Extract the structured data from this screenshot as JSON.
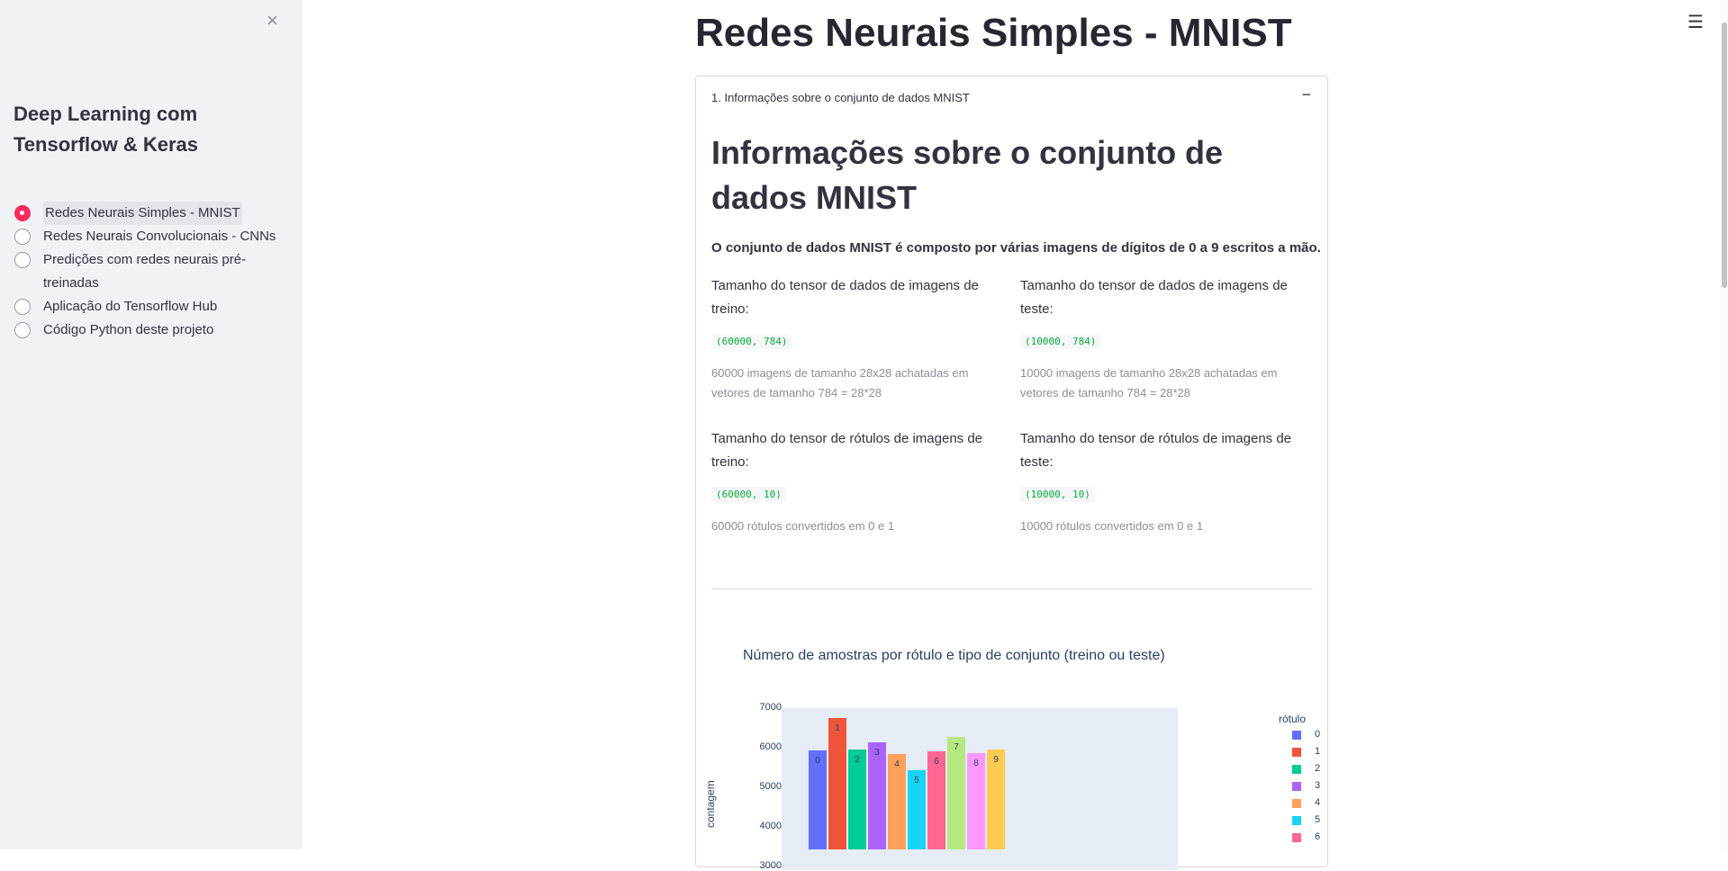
{
  "sidebar": {
    "close_icon": "×",
    "title": "Deep Learning com Tensorflow & Keras",
    "options": [
      {
        "label": "Redes Neurais Simples - MNIST",
        "selected": true
      },
      {
        "label": "Redes Neurais Convolucionais - CNNs",
        "selected": false
      },
      {
        "label": "Predições com redes neurais pré-treinadas",
        "selected": false
      },
      {
        "label": "Aplicação do Tensorflow Hub",
        "selected": false
      },
      {
        "label": "Código Python deste projeto",
        "selected": false
      }
    ]
  },
  "header": {
    "menu_icon": "☰",
    "title": "Redes Neurais Simples - MNIST"
  },
  "expander": {
    "title": "1. Informações sobre o conjunto de dados MNIST",
    "toggle": "−",
    "heading": "Informações sobre o conjunto de dados MNIST",
    "intro": "O conjunto de dados MNIST é composto por várias imagens de dígitos de 0 a 9 escritos a mão.",
    "blocks": [
      {
        "label": "Tamanho do tensor de dados de imagens de treino:",
        "code": "(60000, 784)",
        "caption": "60000 imagens de tamanho 28x28 achatadas em vetores de tamanho 784 = 28*28"
      },
      {
        "label": "Tamanho do tensor de dados de imagens de teste:",
        "code": "(10000, 784)",
        "caption": "10000 imagens de tamanho 28x28 achatadas em vetores de tamanho 784 = 28*28"
      },
      {
        "label": "Tamanho do tensor de rótulos de imagens de treino:",
        "code": "(60000, 10)",
        "caption": "60000 rótulos convertidos em 0 e 1"
      },
      {
        "label": "Tamanho do tensor de rótulos de imagens de teste:",
        "code": "(10000, 10)",
        "caption": "10000 rótulos convertidos em 0 e 1"
      }
    ]
  },
  "chart_data": {
    "type": "bar",
    "title": "Número de amostras por rótulo e tipo de conjunto (treino ou teste)",
    "ylabel": "contagem",
    "y_ticks": [
      3000,
      4000,
      5000,
      6000,
      7000
    ],
    "ylim": [
      0,
      7000
    ],
    "legend_title": "rótulo",
    "legend_placement": "right",
    "categories": [
      "0",
      "1",
      "2",
      "3",
      "4",
      "5",
      "6",
      "7",
      "8",
      "9"
    ],
    "values": [
      5923,
      6742,
      5958,
      6131,
      5842,
      5421,
      5918,
      6265,
      5851,
      5949
    ],
    "colors": [
      "#636efa",
      "#ef553b",
      "#00cc96",
      "#ab63fa",
      "#ffa15a",
      "#19d3f3",
      "#ff6692",
      "#b6e880",
      "#ff97ff",
      "#fecb52"
    ],
    "legend_visible": [
      "0",
      "1",
      "2",
      "3",
      "4",
      "5",
      "6"
    ]
  }
}
